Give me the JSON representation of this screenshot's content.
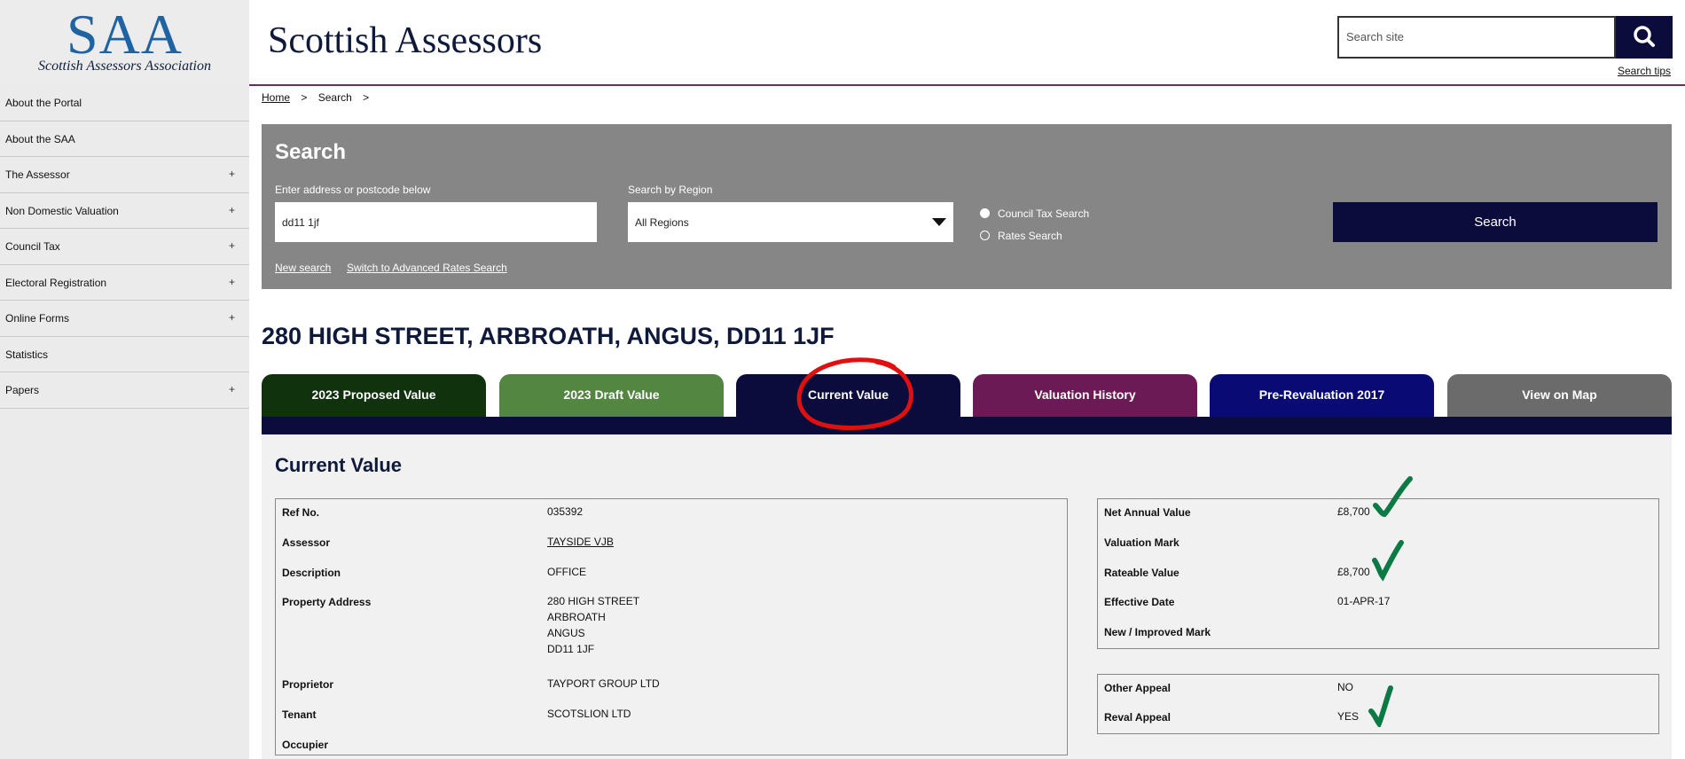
{
  "logo": {
    "acronym": "SAA",
    "subtitle": "Scottish Assessors Association"
  },
  "header": {
    "title": "Scottish Assessors",
    "search_placeholder": "Search site",
    "search_tips": "Search tips"
  },
  "sidebar": {
    "items": [
      {
        "label": "About the Portal",
        "expand": ""
      },
      {
        "label": "About the SAA",
        "expand": ""
      },
      {
        "label": "The Assessor",
        "expand": "+"
      },
      {
        "label": "Non Domestic Valuation",
        "expand": "+"
      },
      {
        "label": "Council Tax",
        "expand": "+"
      },
      {
        "label": "Electoral Registration",
        "expand": "+"
      },
      {
        "label": "Online Forms",
        "expand": "+"
      },
      {
        "label": "Statistics",
        "expand": ""
      },
      {
        "label": "Papers",
        "expand": "+"
      }
    ]
  },
  "breadcrumb": {
    "home": "Home",
    "sep": ">",
    "current": "Search"
  },
  "search_panel": {
    "heading": "Search",
    "address_label": "Enter address or postcode below",
    "address_value": "dd11 1jf",
    "region_label": "Search by Region",
    "region_value": "All Regions",
    "radio_council_tax": "Council Tax Search",
    "radio_rates": "Rates Search",
    "radio_selected": "Council Tax Search",
    "search_button": "Search",
    "new_search": "New search",
    "advanced": "Switch to Advanced Rates Search"
  },
  "property": {
    "address_heading": "280 HIGH STREET, ARBROATH, ANGUS, DD11 1JF"
  },
  "tabs": [
    {
      "label": "2023 Proposed Value",
      "color": "#10330e"
    },
    {
      "label": "2023 Draft Value",
      "color": "#528641"
    },
    {
      "label": "Current Value",
      "color": "#0b0c3c",
      "active": true
    },
    {
      "label": "Valuation History",
      "color": "#6c1a55"
    },
    {
      "label": "Pre-Revaluation 2017",
      "color": "#0a0a74"
    },
    {
      "label": "View on Map",
      "color": "#6b6b6b"
    }
  ],
  "current_value": {
    "heading": "Current Value",
    "details": {
      "ref_no_label": "Ref No.",
      "ref_no": "035392",
      "assessor_label": "Assessor",
      "assessor": "TAYSIDE VJB",
      "description_label": "Description",
      "description": "OFFICE",
      "property_address_label": "Property Address",
      "address_line1": "280 HIGH STREET",
      "address_line2": "ARBROATH",
      "address_line3": "ANGUS",
      "address_line4": "DD11 1JF",
      "proprietor_label": "Proprietor",
      "proprietor": "TAYPORT GROUP LTD",
      "tenant_label": "Tenant",
      "tenant": "SCOTSLION LTD",
      "occupier_label": "Occupier",
      "occupier": ""
    },
    "valuation": {
      "net_annual_value_label": "Net Annual Value",
      "net_annual_value": "£8,700",
      "valuation_mark_label": "Valuation Mark",
      "valuation_mark": "",
      "rateable_value_label": "Rateable Value",
      "rateable_value": "£8,700",
      "effective_date_label": "Effective Date",
      "effective_date": "01-APR-17",
      "new_improved_mark_label": "New / Improved Mark",
      "new_improved_mark": ""
    },
    "appeals": {
      "other_appeal_label": "Other Appeal",
      "other_appeal": "NO",
      "reval_appeal_label": "Reval Appeal",
      "reval_appeal": "YES"
    }
  },
  "annotations": {
    "circle_color": "#e01010",
    "check_color": "#0b7a45",
    "circle_icon": "red-circle-annotation",
    "check_icon": "green-checkmark"
  }
}
